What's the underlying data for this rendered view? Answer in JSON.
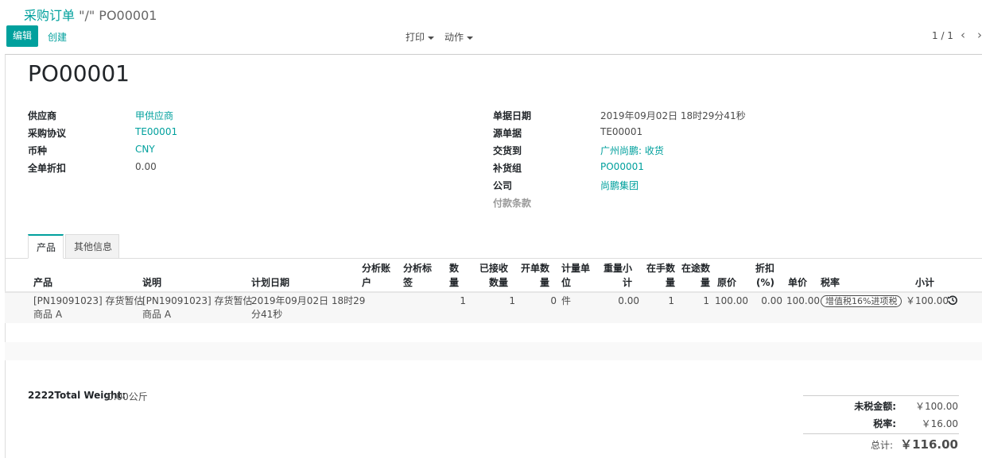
{
  "breadcrumb": {
    "parent": "采购订单",
    "separator": " \"/\" ",
    "current": "PO00001"
  },
  "toolbar": {
    "edit_label": "编辑",
    "create_label": "创建",
    "print_label": "打印",
    "action_label": "动作",
    "pager": "1 / 1",
    "prev_icon": "‹",
    "next_icon": "›"
  },
  "form": {
    "title": "PO00001",
    "left": {
      "vendor_label": "供应商",
      "vendor_value": "甲供应商",
      "agreement_label": "采购协议",
      "agreement_value": "TE00001",
      "currency_label": "币种",
      "currency_value": "CNY",
      "discount_label": "全单折扣",
      "discount_value": "0.00"
    },
    "right": {
      "date_label": "单据日期",
      "date_value": "2019年09月02日 18时29分41秒",
      "source_label": "源单据",
      "source_value": "TE00001",
      "deliver_label": "交货到",
      "deliver_value": "广州尚鹏: 收货",
      "group_label": "补货组",
      "group_value": "PO00001",
      "company_label": "公司",
      "company_value": "尚鹏集团",
      "payment_label": "付款条款"
    }
  },
  "tabs": [
    {
      "label": "产品"
    },
    {
      "label": "其他信息"
    }
  ],
  "table": {
    "headers": {
      "product": "产品",
      "desc": "说明",
      "date": "计划日期",
      "analytic_acc_1": "分析账",
      "analytic_acc_2": "户",
      "analytic_tag_1": "分析标",
      "analytic_tag_2": "签",
      "qty_1": "数",
      "qty_2": "量",
      "received_1": "已接收",
      "received_2": "数量",
      "billed_1": "开单数",
      "billed_2": "量",
      "uom_1": "计量单",
      "uom_2": "位",
      "weight_1": "重量小",
      "weight_2": "计",
      "onhand_1": "在手数",
      "onhand_2": "量",
      "transit_1": "在途数",
      "transit_2": "量",
      "price": "原价",
      "discount_1": "折扣",
      "discount_2": "(%)",
      "unit_price": "单价",
      "tax": "税率",
      "subtotal": "小计"
    },
    "row": {
      "product_1": "[PN19091023] 存货暂估",
      "product_2": "商品 A",
      "desc_1": "[PN19091023] 存货暂估",
      "desc_2": "商品 A",
      "date_1": "2019年09月02日 18时29",
      "date_2": "分41秒",
      "qty": "1",
      "received": "1",
      "billed": "0",
      "uom": "件",
      "weight": "0.00",
      "onhand": "1",
      "transit": "1",
      "price": "100.00",
      "discount": "0.00",
      "unit_price": "100.00",
      "tax": "增值税16%进项税",
      "subtotal": "￥100.00"
    }
  },
  "footer": {
    "weight_label": "2222Total Weight:",
    "weight_value": "0.00公斤",
    "untaxed_label": "未税金额:",
    "untaxed_value": "￥100.00",
    "tax_label": "税率:",
    "tax_value": "￥16.00",
    "total_label": "总计:",
    "total_value": "￥116.00"
  },
  "colors": {
    "accent": "#00a09d",
    "text": "#4c4c4c",
    "heading": "#212529"
  }
}
